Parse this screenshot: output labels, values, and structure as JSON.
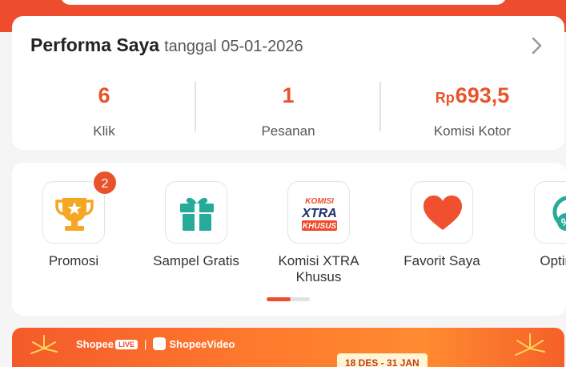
{
  "performance": {
    "title": "Performa Saya",
    "date_text": "tanggal 05-01-2026",
    "stats": [
      {
        "value": "6",
        "label": "Klik"
      },
      {
        "value": "1",
        "label": "Pesanan"
      },
      {
        "currency": "Rp",
        "value": "693,5",
        "label": "Komisi Kotor"
      }
    ]
  },
  "menu": {
    "items": [
      {
        "label": "Promosi",
        "icon": "trophy-icon",
        "badge": "2"
      },
      {
        "label": "Sampel Gratis",
        "icon": "gift-icon"
      },
      {
        "label": "Komisi XTRA Khusus",
        "icon": "komisi-xtra-icon",
        "icon_text": [
          "KOMISI",
          "XTRA",
          "KHUSUS"
        ]
      },
      {
        "label": "Favorit Saya",
        "icon": "heart-icon"
      },
      {
        "label": "Optimas",
        "icon": "optimization-icon"
      }
    ],
    "page_indicator_progress": 0.55
  },
  "banner": {
    "brand_left": "Shopee",
    "brand_live": "LIVE",
    "brand_right": "ShopeeVideo",
    "date_range": "18 DES - 31 JAN"
  },
  "colors": {
    "accent": "#ee4d2d",
    "value": "#e8532c",
    "trophy": "#f5a623",
    "gift": "#26aa99",
    "heart": "#f0502f"
  }
}
